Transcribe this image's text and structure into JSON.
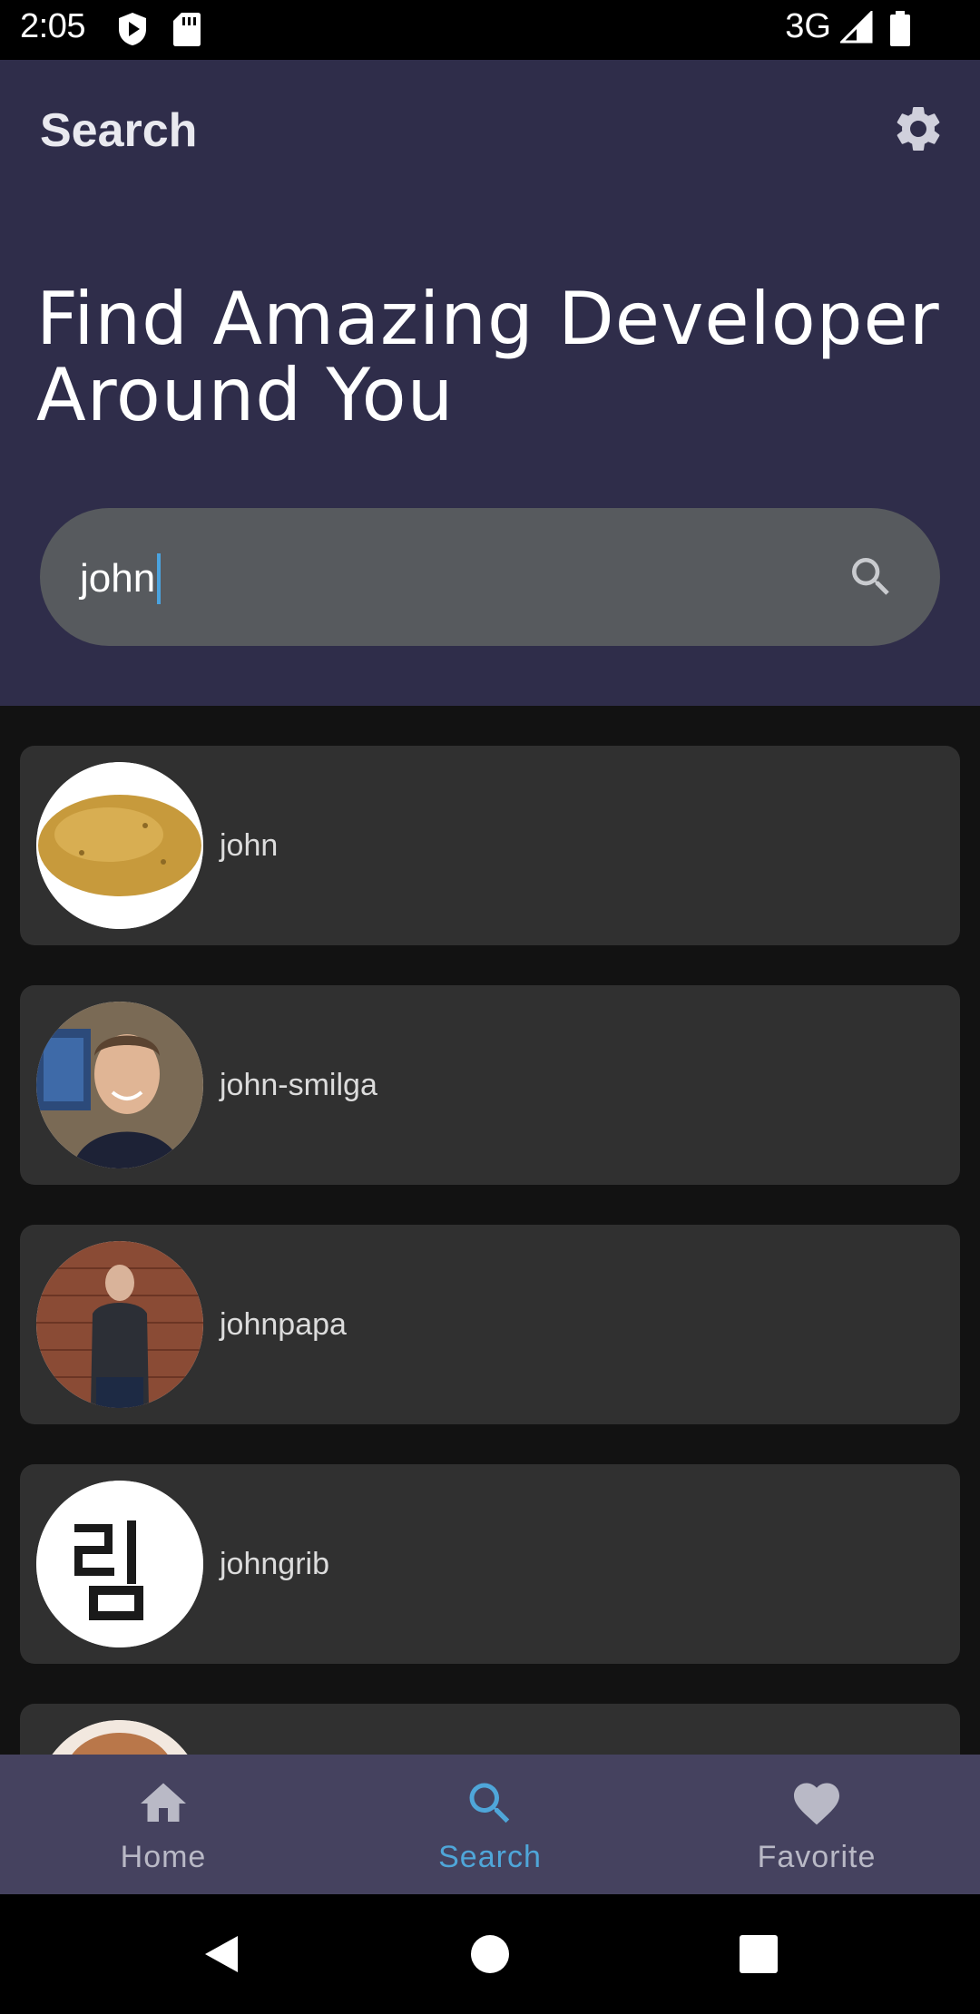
{
  "status_bar": {
    "time": "2:05",
    "network": "3G"
  },
  "header": {
    "title": "Search",
    "headline_line1": "Find Amazing Developer",
    "headline_line2": "Around You"
  },
  "search": {
    "value": "john",
    "icon": "search-icon"
  },
  "results": [
    {
      "login": "john",
      "avatar": "potato"
    },
    {
      "login": "john-smilga",
      "avatar": "man-smiling"
    },
    {
      "login": "johnpapa",
      "avatar": "man-brick-wall"
    },
    {
      "login": "johngrib",
      "avatar": "hangul-glyph"
    },
    {
      "login": "",
      "avatar": "partial-person"
    }
  ],
  "bottom_nav": {
    "items": [
      {
        "label": "Home",
        "icon": "home-icon",
        "active": false
      },
      {
        "label": "Search",
        "icon": "search-icon",
        "active": true
      },
      {
        "label": "Favorite",
        "icon": "heart-icon",
        "active": false
      }
    ]
  },
  "colors": {
    "header_bg": "#2f2d4a",
    "search_bg": "#575a5e",
    "card_bg": "#303030",
    "nav_bg": "#45425f",
    "accent": "#4fa6d9"
  }
}
